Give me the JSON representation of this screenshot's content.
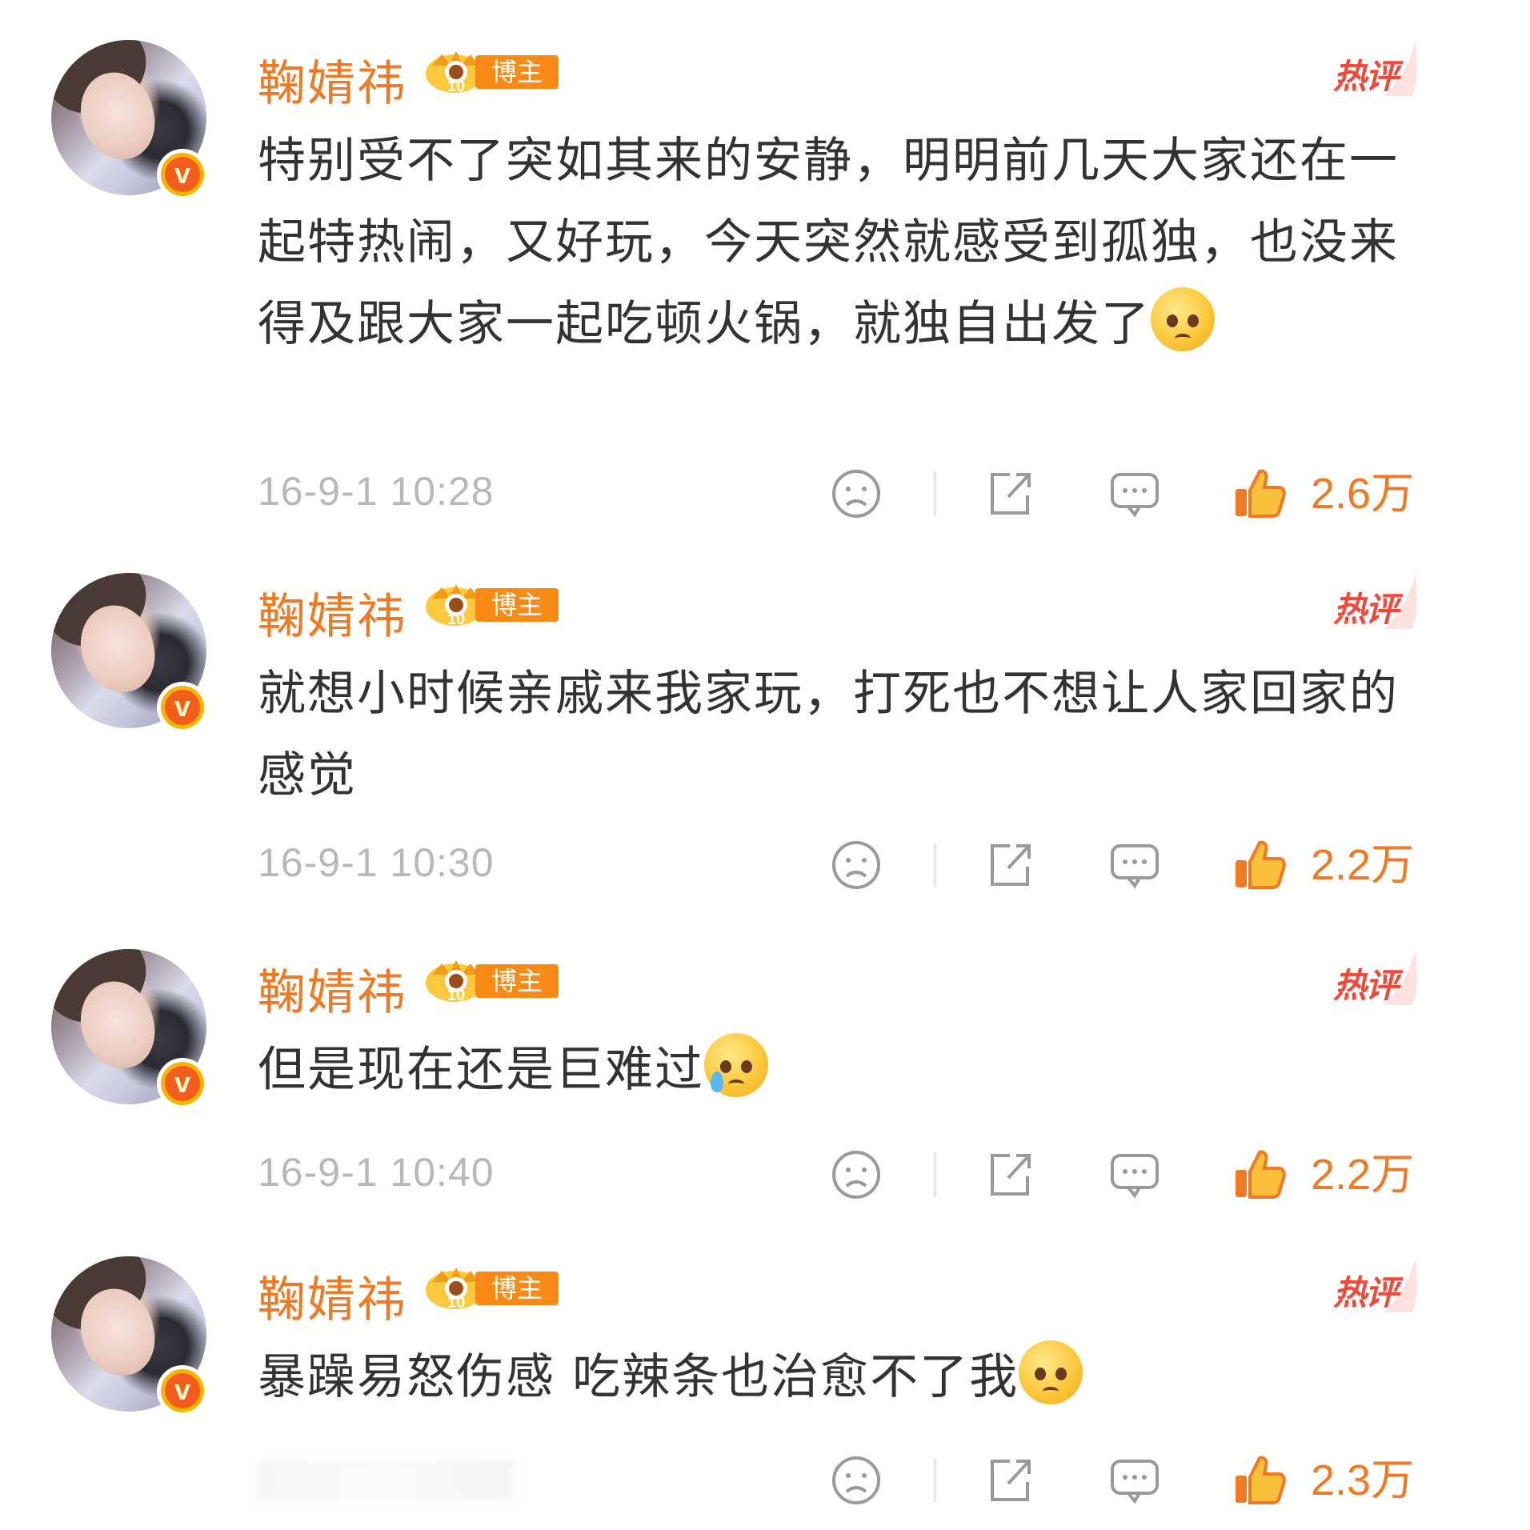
{
  "colors": {
    "username": "#f07a24",
    "hot": "#f04a3a",
    "badge": "#fa8a16",
    "text": "#333333",
    "meta": "#b8b8b8",
    "like": "#f07a24"
  },
  "comments": [
    {
      "username": "鞠婧祎",
      "badge_label": "博主",
      "hot_label": "热评",
      "text": "特别受不了突如其来的安静，明明前几天大家还在一起特热闹，又好玩，今天突然就感受到孤独，也没来得及跟大家一起吃顿火锅，就独自出发了",
      "emoji": "pleading-face",
      "timestamp": "16-9-1 10:28",
      "likes": "2.6万"
    },
    {
      "username": "鞠婧祎",
      "badge_label": "博主",
      "hot_label": "热评",
      "text": "就想小时候亲戚来我家玩，打死也不想让人家回家的感觉",
      "emoji": "",
      "timestamp": "16-9-1 10:30",
      "likes": "2.2万"
    },
    {
      "username": "鞠婧祎",
      "badge_label": "博主",
      "hot_label": "热评",
      "text": "但是现在还是巨难过",
      "emoji": "crying-face",
      "timestamp": "16-9-1 10:40",
      "likes": "2.2万"
    },
    {
      "username": "鞠婧祎",
      "badge_label": "博主",
      "hot_label": "热评",
      "text": "暴躁易怒伤感 吃辣条也治愈不了我",
      "emoji": "pleading-face",
      "timestamp": "",
      "likes": "2.3万"
    }
  ],
  "icons": {
    "dislike": "frown-face-icon",
    "share": "share-icon",
    "reply": "comment-bubble-icon",
    "like": "thumbs-up-icon",
    "verified": "verified-v-icon",
    "crown": "crown-level-icon"
  }
}
